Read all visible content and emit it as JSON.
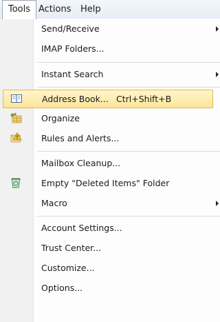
{
  "menubar": {
    "tools": "Tools",
    "actions": "Actions",
    "help": "Help"
  },
  "menu": {
    "send_receive": "Send/Receive",
    "imap_folders": "IMAP Folders...",
    "instant_search": "Instant Search",
    "address_book": "Address Book...",
    "address_book_shortcut": "Ctrl+Shift+B",
    "organize": "Organize",
    "rules_alerts": "Rules and Alerts...",
    "mailbox_cleanup": "Mailbox Cleanup...",
    "empty_deleted": "Empty \"Deleted Items\" Folder",
    "macro": "Macro",
    "account_settings": "Account Settings...",
    "trust_center": "Trust Center...",
    "customize": "Customize...",
    "options": "Options..."
  },
  "icons": {
    "address_book": "address-book-icon",
    "organize": "organize-icon",
    "rules_alerts": "rules-alerts-icon",
    "empty_deleted": "recycle-bin-icon"
  },
  "colors": {
    "highlight_fill": "#fde598",
    "highlight_border": "#e0b84a"
  }
}
